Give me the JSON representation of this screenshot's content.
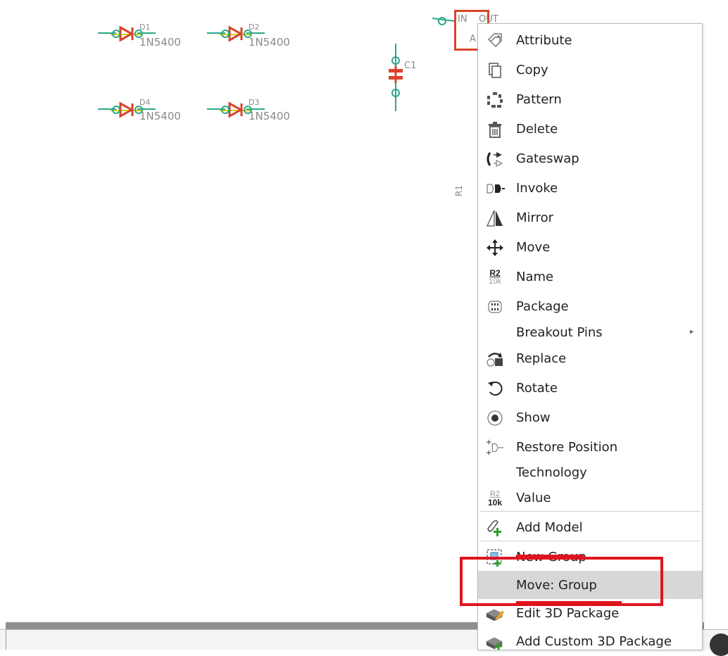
{
  "schematic": {
    "diodes": [
      {
        "ref": "D1",
        "value": "1N5400"
      },
      {
        "ref": "D2",
        "value": "1N5400"
      },
      {
        "ref": "D4",
        "value": "1N5400"
      },
      {
        "ref": "D3",
        "value": "1N5400"
      }
    ],
    "capacitor": {
      "ref": "C1"
    },
    "resistor": {
      "ref": "R1"
    },
    "chip": {
      "in_label": "IN",
      "out_label": "OUT",
      "adj_label": "A"
    }
  },
  "context_menu": {
    "items": [
      {
        "label": "Attribute",
        "icon": "tag-icon"
      },
      {
        "label": "Copy",
        "icon": "copy-icon"
      },
      {
        "label": "Pattern",
        "icon": "pattern-icon"
      },
      {
        "label": "Delete",
        "icon": "trash-icon"
      },
      {
        "label": "Gateswap",
        "icon": "gateswap-icon"
      },
      {
        "label": "Invoke",
        "icon": "invoke-icon"
      },
      {
        "label": "Mirror",
        "icon": "mirror-icon"
      },
      {
        "label": "Move",
        "icon": "move-icon"
      },
      {
        "label": "Name",
        "icon": "name-icon",
        "icon_top": "R2",
        "icon_bottom": "10k"
      },
      {
        "label": "Package",
        "icon": "package-icon"
      },
      {
        "label": "Breakout Pins",
        "icon": "",
        "submenu_arrow": "►"
      },
      {
        "label": "Replace",
        "icon": "replace-icon"
      },
      {
        "label": "Rotate",
        "icon": "rotate-icon"
      },
      {
        "label": "Show",
        "icon": "eye-icon"
      },
      {
        "label": "Restore Position",
        "icon": "restore-position-icon"
      },
      {
        "label": "Technology",
        "icon": ""
      },
      {
        "label": "Value",
        "icon": "value-icon",
        "icon_top": "R2",
        "icon_bottom": "10k"
      },
      {
        "label": "Add Model",
        "icon": "add-model-icon"
      },
      {
        "label": "New Group",
        "icon": "new-group-icon"
      },
      {
        "label": "Move: Group",
        "icon": "",
        "highlighted": true
      },
      {
        "label": "Edit 3D Package",
        "icon": "edit-3d-package-icon"
      },
      {
        "label": "Add Custom 3D Package",
        "icon": "add-custom-3d-package-icon"
      }
    ]
  },
  "colors": {
    "accent_red": "#e0141e",
    "part_red": "#d9432b",
    "pin_green": "#2aa88a",
    "wire_yellow": "#d8d000",
    "highlight": "#d7d7d7"
  }
}
